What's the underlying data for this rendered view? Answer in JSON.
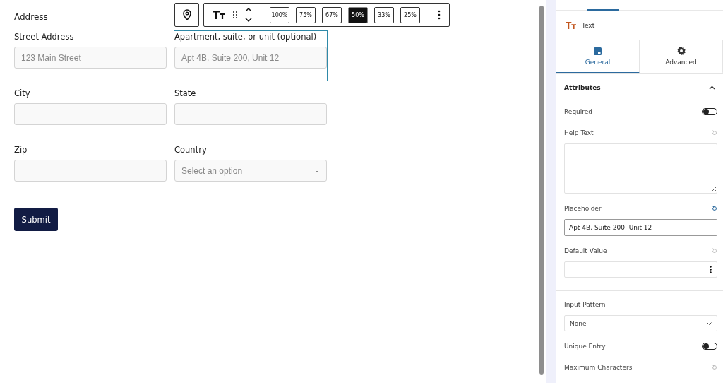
{
  "form": {
    "title": "Address",
    "fields": [
      {
        "kind": "input",
        "label": "Street Address",
        "placeholder": "123 Main Street",
        "selected": false
      },
      {
        "kind": "input",
        "label": "Apartment, suite, or unit (optional)",
        "placeholder": "Apt 4B, Suite 200, Unit 12",
        "selected": true
      },
      {
        "kind": "input",
        "label": "City",
        "selected": false
      },
      {
        "kind": "input",
        "label": "State",
        "selected": false
      },
      {
        "kind": "input",
        "label": "Zip",
        "selected": false
      },
      {
        "kind": "select",
        "label": "Country",
        "placeholder": "Select an option",
        "selected": false
      }
    ],
    "submit": "Submit"
  },
  "toolbar": {
    "widths": [
      {
        "label": "100%",
        "selected": false
      },
      {
        "label": "75%",
        "selected": false
      },
      {
        "label": "67%",
        "selected": false
      },
      {
        "label": "50%",
        "selected": true
      },
      {
        "label": "33%",
        "selected": false
      },
      {
        "label": "25%",
        "selected": false
      }
    ]
  },
  "sidebar": {
    "block": "Text",
    "tabs": [
      {
        "label": "General",
        "selected": true
      },
      {
        "label": "Advanced",
        "selected": false
      }
    ],
    "section": {
      "title": "Attributes",
      "expanded": true,
      "groups": [
        [
          {
            "kind": "toggle",
            "label": "Required",
            "on": false
          },
          {
            "kind": "textarea",
            "label": "Help Text",
            "modified": false
          },
          {
            "kind": "text",
            "label": "Placeholder",
            "value": "Apt 4B, Suite 200, Unit 12",
            "modified": true
          },
          {
            "kind": "menu-input",
            "label": "Default Value",
            "modified": false
          }
        ],
        [
          {
            "kind": "select",
            "label": "Input Pattern",
            "value": "None"
          },
          {
            "kind": "toggle",
            "label": "Unique Entry",
            "on": false
          },
          {
            "kind": "reset",
            "label": "Maximum Characters",
            "modified": false
          }
        ]
      ]
    }
  }
}
